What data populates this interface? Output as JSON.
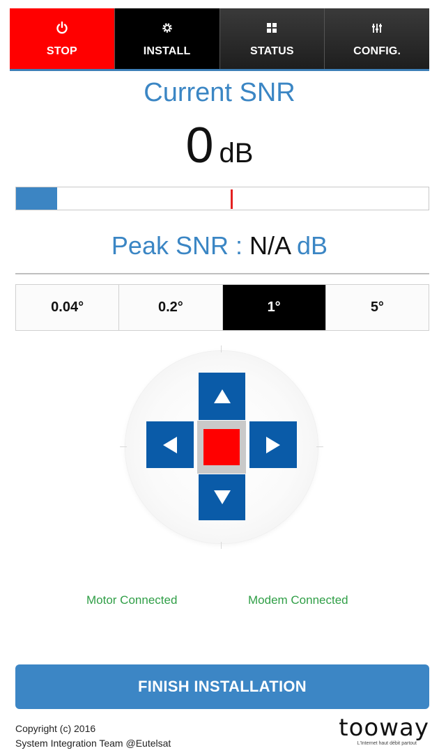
{
  "nav": {
    "items": [
      {
        "label": "STOP",
        "icon": "power-icon"
      },
      {
        "label": "INSTALL",
        "icon": "gear-icon"
      },
      {
        "label": "STATUS",
        "icon": "grid-icon"
      },
      {
        "label": "CONFIG.",
        "icon": "sliders-icon"
      }
    ],
    "active": "INSTALL"
  },
  "snr": {
    "title": "Current SNR",
    "value": "0",
    "unit": "dB",
    "bar_level": 0.1,
    "marker_level": 0.52
  },
  "peak": {
    "label": "Peak SNR : ",
    "value": "N/A",
    "unit": " dB"
  },
  "steps": {
    "options": [
      "0.04°",
      "0.2°",
      "1°",
      "5°"
    ],
    "selected": "1°"
  },
  "joystick": {
    "up_icon": "arrow-up-icon",
    "down_icon": "arrow-down-icon",
    "left_icon": "arrow-left-icon",
    "right_icon": "arrow-right-icon",
    "center": "stop-square"
  },
  "status": {
    "motor": "Motor Connected",
    "modem": "Modem Connected"
  },
  "finish_label": "FINISH INSTALLATION",
  "footer": {
    "line1": "Copyright (c) 2016",
    "line2": "System Integration Team @Eutelsat"
  },
  "brand": {
    "name": "tooway",
    "tagline": "L'Internet haut débit partout"
  },
  "colors": {
    "accent": "#3c86c5",
    "stop": "#ff0000",
    "dpad": "#0a5ba8",
    "status_ok": "#2f9e46"
  }
}
